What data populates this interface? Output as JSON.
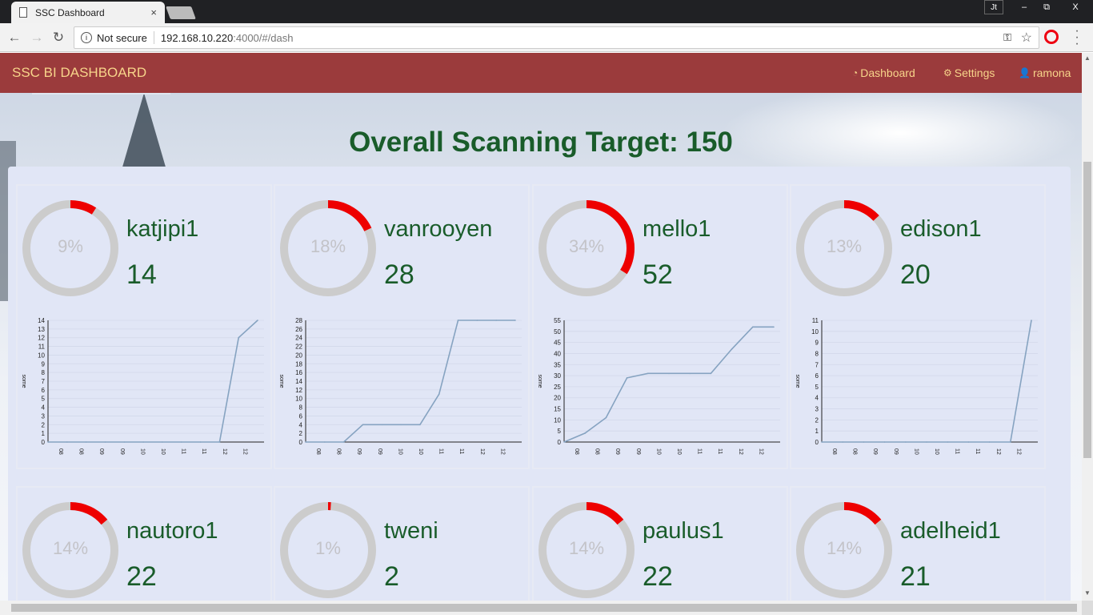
{
  "browser": {
    "tab_title": "SSC Dashboard",
    "tab_close": "×",
    "profile": "Jt",
    "minimize": "–",
    "restore": "⧉",
    "close": "X",
    "security": "Not secure",
    "url_host": "192.168.10.220",
    "url_path": ":4000/#/dash"
  },
  "navbar": {
    "brand": "SSC BI DASHBOARD",
    "links": [
      {
        "label": "Dashboard",
        "icon": "dashboard-icon"
      },
      {
        "label": "Settings",
        "icon": "gear-icon"
      },
      {
        "label": "ramona",
        "icon": "user-icon"
      }
    ]
  },
  "heading": "Overall Scanning Target: 150",
  "colors": {
    "progress": "#ee0000",
    "track": "#cccccc",
    "text": "#195c2a",
    "line": "#86a3c1",
    "navbar": "#9b3b3c"
  },
  "users": [
    {
      "name": "katjipi1",
      "percent": "9%",
      "fraction": 0.09,
      "count": "14"
    },
    {
      "name": "vanrooyen",
      "percent": "18%",
      "fraction": 0.18,
      "count": "28"
    },
    {
      "name": "mello1",
      "percent": "34%",
      "fraction": 0.34,
      "count": "52"
    },
    {
      "name": "edison1",
      "percent": "13%",
      "fraction": 0.13,
      "count": "20"
    },
    {
      "name": "nautoro1",
      "percent": "14%",
      "fraction": 0.14,
      "count": "22"
    },
    {
      "name": "tweni",
      "percent": "1%",
      "fraction": 0.01,
      "count": "2"
    },
    {
      "name": "paulus1",
      "percent": "14%",
      "fraction": 0.14,
      "count": "22"
    },
    {
      "name": "adelheid1",
      "percent": "14%",
      "fraction": 0.14,
      "count": "21"
    }
  ],
  "chart_data": [
    {
      "type": "line",
      "ylabel": "some",
      "ylim": [
        0,
        14
      ],
      "yticks": [
        0,
        1,
        2,
        3,
        4,
        5,
        6,
        7,
        8,
        9,
        10,
        11,
        12,
        13,
        14
      ],
      "xticklabels": [
        "08",
        "08",
        "09",
        "09",
        "10",
        "10",
        "11",
        "11",
        "12",
        "12"
      ],
      "series": [
        {
          "values": [
            0,
            0,
            0,
            0,
            0,
            0,
            0,
            0,
            0,
            0,
            12,
            14
          ]
        }
      ]
    },
    {
      "type": "line",
      "ylabel": "some",
      "ylim": [
        0,
        28
      ],
      "yticks": [
        0,
        2,
        4,
        6,
        8,
        10,
        12,
        14,
        16,
        18,
        20,
        22,
        24,
        26,
        28
      ],
      "xticklabels": [
        "08",
        "08",
        "09",
        "09",
        "10",
        "10",
        "11",
        "11",
        "12",
        "12"
      ],
      "series": [
        {
          "values": [
            0,
            0,
            0,
            4,
            4,
            4,
            4,
            11,
            28,
            28,
            28,
            28
          ]
        }
      ]
    },
    {
      "type": "line",
      "ylabel": "some",
      "ylim": [
        0,
        55
      ],
      "yticks": [
        0,
        5,
        10,
        15,
        20,
        25,
        30,
        35,
        40,
        45,
        50,
        55
      ],
      "xticklabels": [
        "08",
        "08",
        "09",
        "09",
        "10",
        "10",
        "11",
        "11",
        "12",
        "12"
      ],
      "series": [
        {
          "values": [
            0,
            4,
            11,
            29,
            31,
            31,
            31,
            31,
            42,
            52,
            52
          ]
        }
      ]
    },
    {
      "type": "line",
      "ylabel": "some",
      "ylim": [
        0,
        11
      ],
      "yticks": [
        0,
        1,
        2,
        3,
        4,
        5,
        6,
        7,
        8,
        9,
        10,
        11
      ],
      "xticklabels": [
        "08",
        "08",
        "09",
        "09",
        "10",
        "10",
        "11",
        "11",
        "12",
        "12"
      ],
      "series": [
        {
          "values": [
            0,
            0,
            0,
            0,
            0,
            0,
            0,
            0,
            0,
            0,
            11
          ]
        }
      ]
    }
  ]
}
